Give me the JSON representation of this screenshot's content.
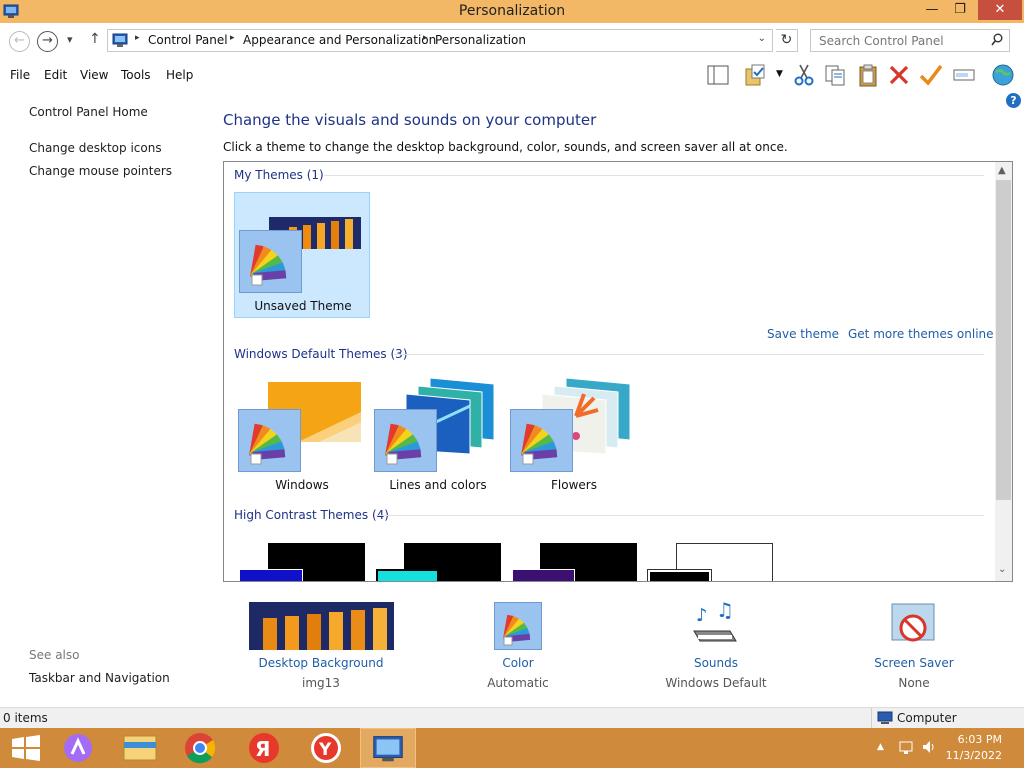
{
  "window": {
    "title": "Personalization",
    "minimize_glyph": "—",
    "maximize_glyph": "❐",
    "close_glyph": "✕"
  },
  "address": {
    "back_glyph": "←",
    "forward_glyph": "→",
    "history_glyph": "▾",
    "up_glyph": "↑",
    "crumbs": [
      "Control Panel",
      "Appearance and Personalization",
      "Personalization"
    ],
    "crumb_separator": "▸",
    "dropdown_glyph": "⌄",
    "refresh_glyph": "↻",
    "search_placeholder": "Search Control Panel"
  },
  "menu": {
    "items": [
      "File",
      "Edit",
      "View",
      "Tools",
      "Help"
    ],
    "toolbar_icons": [
      "layout-icon",
      "properties-icon",
      "cut-icon",
      "copy-icon",
      "paste-icon",
      "delete-icon",
      "checkmark-icon",
      "rename-icon",
      "globe-icon"
    ]
  },
  "help_glyph": "?",
  "left_pane": {
    "links": [
      "Control Panel Home",
      "Change desktop icons",
      "Change mouse pointers"
    ],
    "see_also_label": "See also",
    "see_also_links": [
      "Taskbar and Navigation"
    ]
  },
  "main": {
    "heading": "Change the visuals and sounds on your computer",
    "subheading": "Click a theme to change the desktop background, color, sounds, and screen saver all at once.",
    "my_themes_title": "My Themes (1)",
    "my_themes": [
      {
        "label": "Unsaved Theme",
        "selected": true
      }
    ],
    "save_theme_link": "Save theme",
    "more_themes_link": "Get more themes online",
    "default_themes_title": "Windows Default Themes (3)",
    "default_themes": [
      {
        "label": "Windows"
      },
      {
        "label": "Lines and colors"
      },
      {
        "label": "Flowers"
      }
    ],
    "high_contrast_title": "High Contrast Themes (4)",
    "scroll_up_glyph": "▲",
    "scroll_down_glyph": "⌄"
  },
  "bottom": {
    "desktop_background": {
      "label": "Desktop Background",
      "value": "img13"
    },
    "color": {
      "label": "Color",
      "value": "Automatic"
    },
    "sounds": {
      "label": "Sounds",
      "value": "Windows Default"
    },
    "screen_saver": {
      "label": "Screen Saver",
      "value": "None"
    }
  },
  "status": {
    "items": "0 items",
    "location": "Computer"
  },
  "taskbar": {
    "apps": [
      "windows-start-icon",
      "alice-assistant-icon",
      "file-explorer-icon",
      "chrome-icon",
      "yandex-icon",
      "yandex-browser-icon",
      "control-panel-icon"
    ],
    "time": "6:03 PM",
    "date": "11/3/2022",
    "tray_up_glyph": "▲",
    "accent": "#cf8a3b"
  },
  "colors": {
    "titlebar": "#f2b866",
    "link": "#1f5ea8",
    "heading": "#1e3287",
    "selection": "#cce8ff"
  }
}
